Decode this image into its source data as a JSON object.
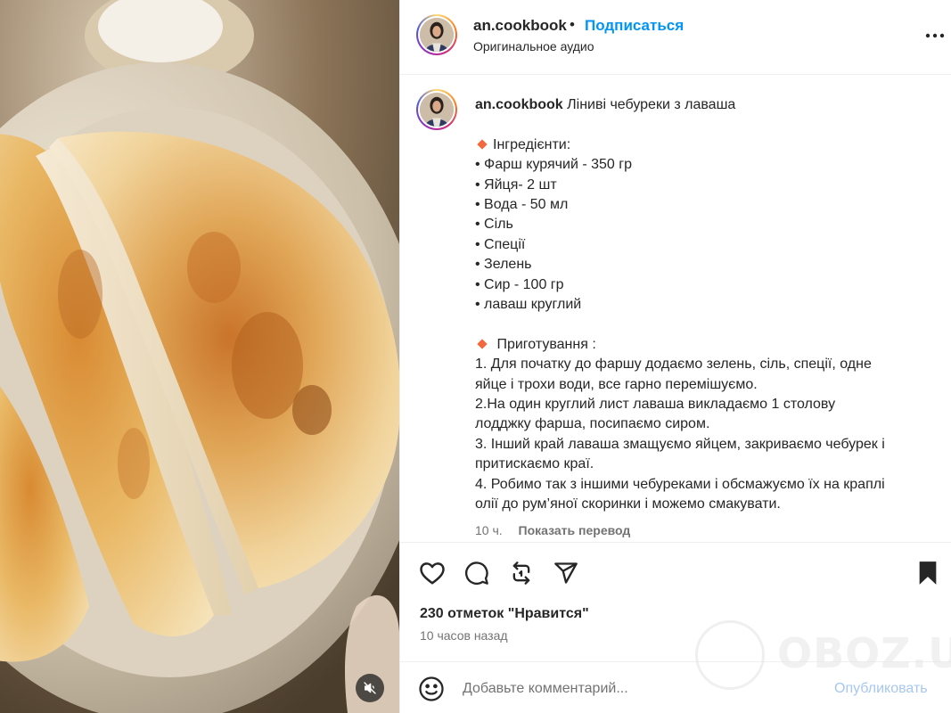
{
  "post": {
    "username": "an.cookbook",
    "separator": "•",
    "follow_label": "Подписаться",
    "audio_label": "Оригинальное аудио",
    "more_label": "⋯"
  },
  "caption": {
    "username": "an.cookbook",
    "title": " Ліниві чебуреки з лаваша",
    "ingredients_heading": "Інгредієнти:",
    "ingredients": [
      "• Фарш курячий - 350 гр",
      "• Яйця- 2 шт",
      "• Вода - 50 мл",
      "• Сіль",
      "• Спеції",
      "• Зелень",
      "• Сир - 100 гр",
      "• лаваш круглий"
    ],
    "method_heading": " Приготування :",
    "steps": [
      "1. Для початку до фаршу додаємо зелень, сіль, спеції, одне",
      "яйце і трохи води, все гарно перемішуємо.",
      "2.На один круглий лист лаваша викладаємо 1 столову",
      "лодджку фарша, посипаємо сиром.",
      "3. Інший край лаваша змащуємо яйцем, закриваємо чебурек і",
      "притискаємо краї.",
      "4. Робимо так з іншими чебуреками і обсмажуємо їх на краплі",
      "олії до рум’яної скоринки і можемо смакувати."
    ],
    "time_ago": "10 ч.",
    "translate_label": "Показать перевод"
  },
  "engagement": {
    "likes_text": "230 отметок \"Нравится\"",
    "posted_ago": "10 часов назад"
  },
  "comment": {
    "placeholder": "Добавьте комментарий...",
    "publish_label": "Опубликовать"
  },
  "watermark": {
    "text": "OBOZ.UA"
  },
  "icons": {
    "like": "heart-icon",
    "comment": "comment-icon",
    "repost": "repost-icon",
    "share": "send-icon",
    "save": "bookmark-icon",
    "mute": "speaker-muted-icon",
    "emoji": "emoji-icon",
    "more": "more-horizontal-icon"
  },
  "colors": {
    "accent": "#0095f6",
    "text": "#262626",
    "secondary": "#737373",
    "publish_disabled": "#a8c7f0",
    "bullet_diamond": "#f26a3c"
  }
}
